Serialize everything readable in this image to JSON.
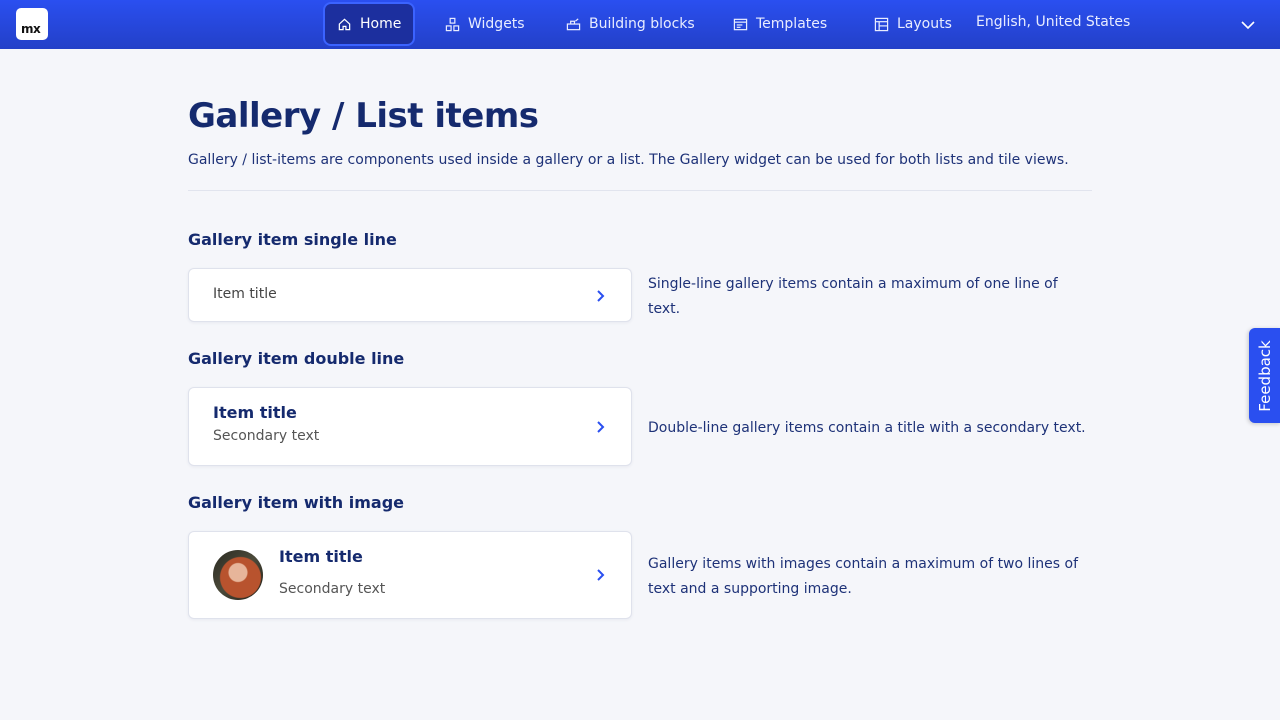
{
  "header": {
    "logo_text": "mx",
    "nav": [
      {
        "label": "Home",
        "icon": "home-icon",
        "active": true
      },
      {
        "label": "Widgets",
        "icon": "widgets-icon"
      },
      {
        "label": "Building blocks",
        "icon": "building-blocks-icon"
      },
      {
        "label": "Templates",
        "icon": "templates-icon"
      },
      {
        "label": "Layouts",
        "icon": "layouts-icon"
      }
    ],
    "language": "English, United States",
    "language_icon": "chevron-down-icon"
  },
  "page": {
    "title": "Gallery / List items",
    "description": "Gallery / list-items are components used inside a gallery or a list. The Gallery widget can be used for both lists and tile views."
  },
  "sections": [
    {
      "title": "Gallery item single line",
      "item_title": "Item title",
      "description": "Single-line gallery items contain a maximum of one line of text."
    },
    {
      "title": "Gallery item double line",
      "item_title": "Item title",
      "item_secondary": "Secondary text",
      "description": "Double-line gallery items contain a title with a secondary text."
    },
    {
      "title": "Gallery item with image",
      "item_title": "Item title",
      "item_secondary": "Secondary text",
      "description": "Gallery items with images contain a maximum of two lines of text and a supporting image."
    }
  ],
  "feedback_label": "Feedback",
  "colors": {
    "header": "#2a4ff0",
    "accent": "#2a4ff0",
    "heading": "#152a6e",
    "background": "#f5f6fa"
  }
}
